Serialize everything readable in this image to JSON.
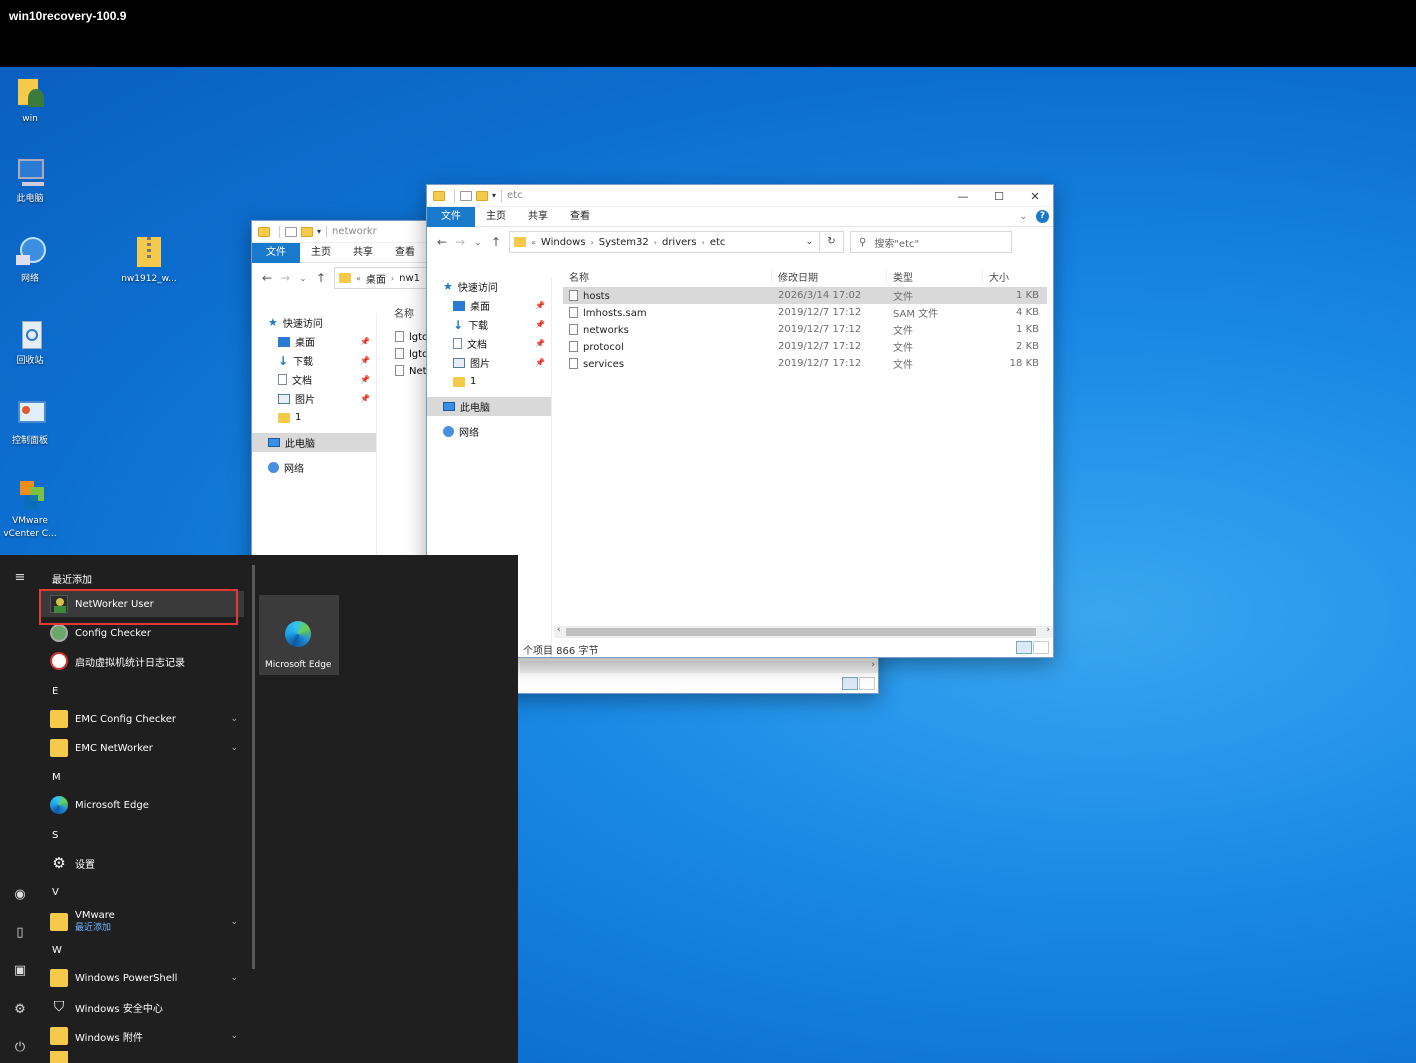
{
  "top_bar": {
    "title": "win10recovery-100.9"
  },
  "desktop_icons": [
    {
      "label": "win",
      "icon": "user-folder-icon"
    },
    {
      "label": "此电脑",
      "icon": "computer-icon"
    },
    {
      "label": "网络",
      "icon": "network-icon"
    },
    {
      "label": "nw1912_w...",
      "icon": "zip-folder-icon"
    },
    {
      "label": "回收站",
      "icon": "recycle-bin-icon"
    },
    {
      "label": "控制面板",
      "icon": "control-panel-icon"
    },
    {
      "label": "VMware vCenter C...",
      "icon": "vmware-icon"
    }
  ],
  "back_window": {
    "title": "networkr",
    "ribbon_tabs": [
      "文件",
      "主页",
      "共享",
      "查看"
    ],
    "breadcrumb": [
      "«",
      "桌面",
      "›",
      "nw1"
    ],
    "column_name": "名称",
    "files": [
      "lgtc",
      "lgtc",
      "Net"
    ],
    "nav_items": [
      {
        "label": "快速访问",
        "pinned": false
      },
      {
        "label": "桌面",
        "pinned": true
      },
      {
        "label": "下载",
        "pinned": true
      },
      {
        "label": "文档",
        "pinned": true
      },
      {
        "label": "图片",
        "pinned": true
      },
      {
        "label": "1",
        "pinned": false
      },
      {
        "label": "此电脑",
        "pinned": false
      },
      {
        "label": "网络",
        "pinned": false
      }
    ]
  },
  "front_window": {
    "title": "etc",
    "ribbon_tabs": [
      "文件",
      "主页",
      "共享",
      "查看"
    ],
    "breadcrumb": [
      "«",
      "Windows",
      "System32",
      "drivers",
      "etc"
    ],
    "search_placeholder": "搜索\"etc\"",
    "nav_items": [
      {
        "label": "快速访问",
        "pinned": false
      },
      {
        "label": "桌面",
        "pinned": true
      },
      {
        "label": "下载",
        "pinned": true
      },
      {
        "label": "文档",
        "pinned": true
      },
      {
        "label": "图片",
        "pinned": true
      },
      {
        "label": "1",
        "pinned": false
      },
      {
        "label": "此电脑",
        "pinned": false
      },
      {
        "label": "网络",
        "pinned": false
      }
    ],
    "columns": [
      "名称",
      "修改日期",
      "类型",
      "大小"
    ],
    "files": [
      {
        "name": "hosts",
        "date": "2026/3/14 17:02",
        "type": "文件",
        "size": "1 KB"
      },
      {
        "name": "lmhosts.sam",
        "date": "2019/12/7 17:12",
        "type": "SAM 文件",
        "size": "4 KB"
      },
      {
        "name": "networks",
        "date": "2019/12/7 17:12",
        "type": "文件",
        "size": "1 KB"
      },
      {
        "name": "protocol",
        "date": "2019/12/7 17:12",
        "type": "文件",
        "size": "2 KB"
      },
      {
        "name": "services",
        "date": "2019/12/7 17:12",
        "type": "文件",
        "size": "18 KB"
      }
    ],
    "status": "个项目  866 字节"
  },
  "start_menu": {
    "recent_header": "最近添加",
    "items": [
      {
        "label": "NetWorker User",
        "icon": "networker-icon"
      },
      {
        "label": "Config Checker",
        "icon": "config-checker-icon"
      },
      {
        "label": "启动虚拟机统计日志记录",
        "icon": "no-entry-icon"
      }
    ],
    "groups": [
      {
        "letter": "E",
        "apps": [
          {
            "label": "EMC Config Checker",
            "folder": true
          },
          {
            "label": "EMC NetWorker",
            "folder": true
          }
        ]
      },
      {
        "letter": "M",
        "apps": [
          {
            "label": "Microsoft Edge",
            "folder": false
          }
        ]
      },
      {
        "letter": "S",
        "apps": [
          {
            "label": "设置",
            "folder": false
          }
        ]
      },
      {
        "letter": "V",
        "apps": [
          {
            "label": "VMware",
            "sub": "最近添加",
            "folder": true
          }
        ]
      },
      {
        "letter": "W",
        "apps": [
          {
            "label": "Windows PowerShell",
            "folder": true
          },
          {
            "label": "Windows 安全中心",
            "folder": false
          },
          {
            "label": "Windows 附件",
            "folder": true
          }
        ]
      }
    ],
    "tile": {
      "label": "Microsoft Edge"
    }
  }
}
